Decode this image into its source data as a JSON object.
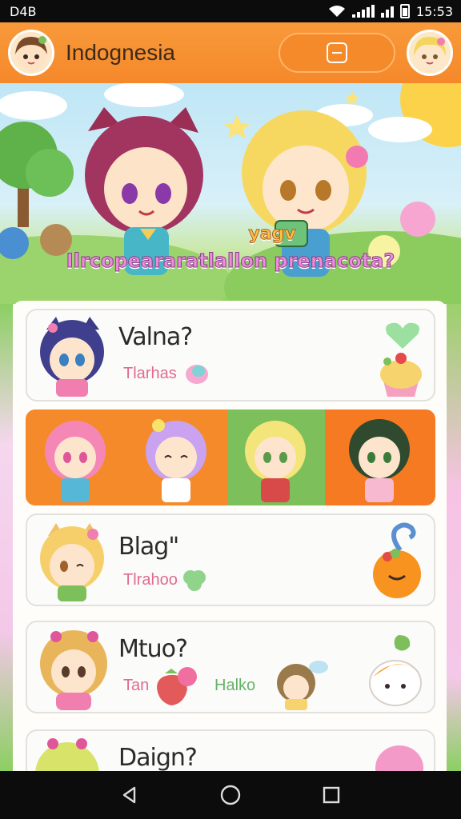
{
  "status_bar": {
    "left_text": "D4B",
    "time": "15:53"
  },
  "app_bar": {
    "title": "Indognesia",
    "search_icon": "minus-square-icon"
  },
  "banner": {
    "caption_top": "yagv",
    "caption_bottom": "Ilrcopeararatlallon prenacota?"
  },
  "cards": [
    {
      "title": "Valna?",
      "subtitle": "Tlarhas"
    },
    {
      "title": "Blag\"",
      "subtitle": "Tlrahoo"
    },
    {
      "title": "Mtuo?",
      "subtitle": "Tan",
      "subtitle2": "Halko"
    },
    {
      "title": "Daign?"
    }
  ],
  "colors": {
    "accent": "#f5882a",
    "nav": "#0c0c0c",
    "green": "#7dbf5a"
  }
}
